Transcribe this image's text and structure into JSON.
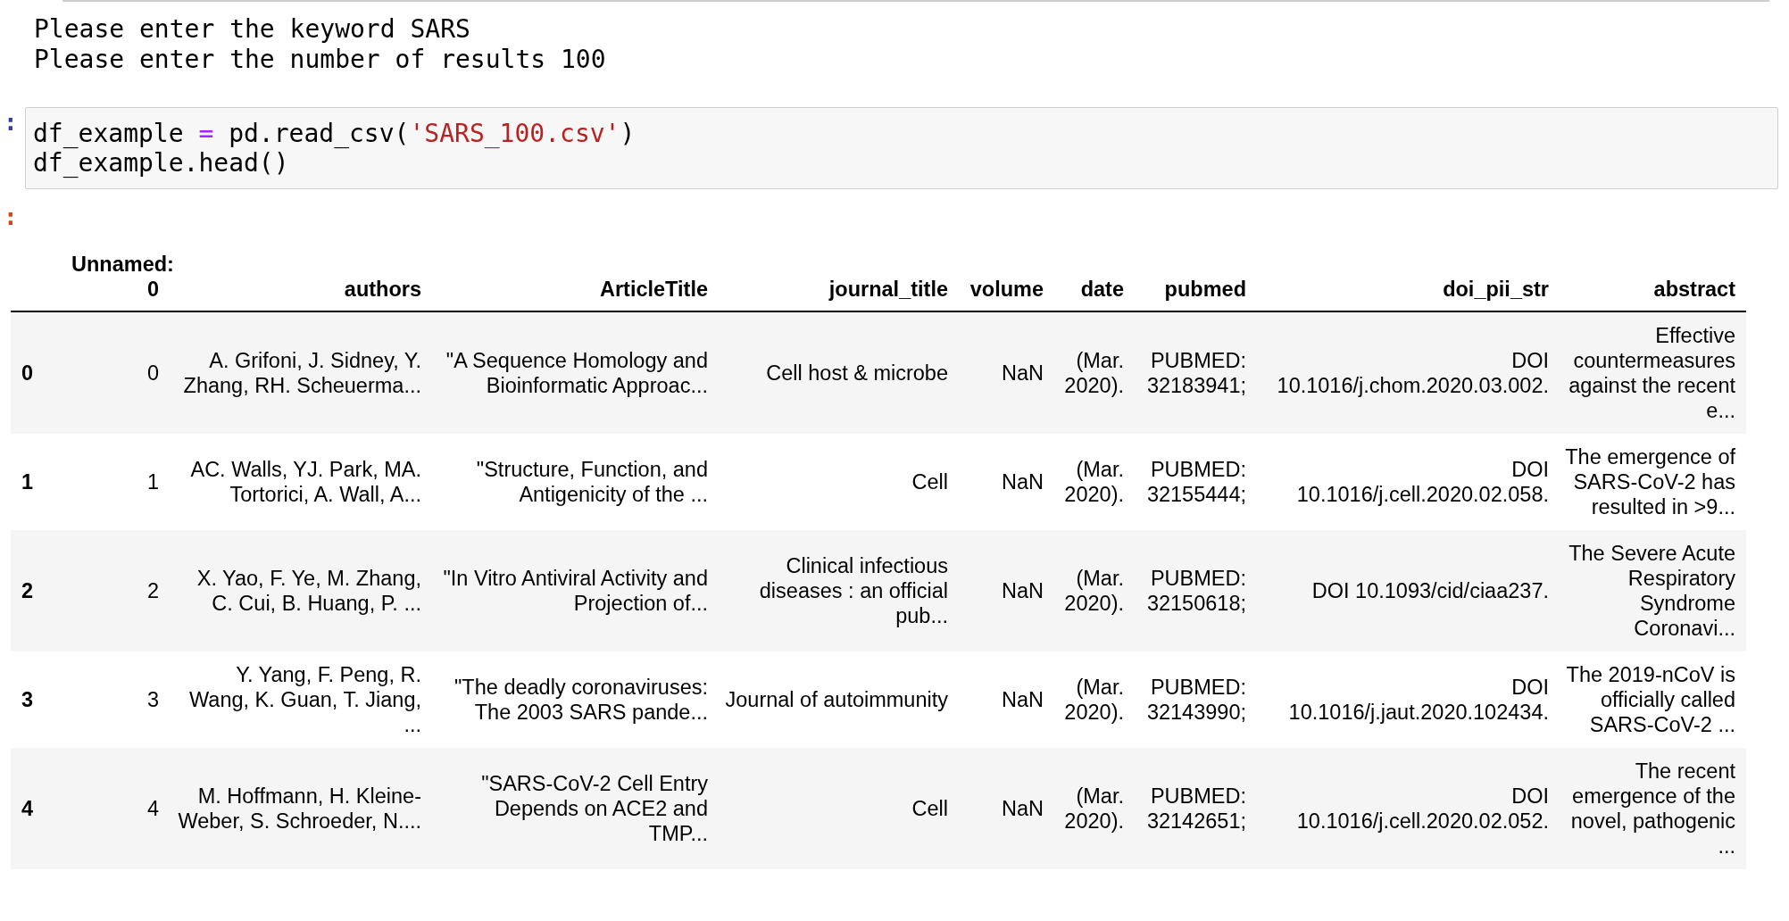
{
  "stdout_lines": [
    "Please enter the keyword SARS",
    "Please enter the number of results 100"
  ],
  "code_cell": {
    "prompt": ":",
    "lines": [
      [
        {
          "text": "df_example ",
          "kind": "plain"
        },
        {
          "text": "=",
          "kind": "operator"
        },
        {
          "text": " pd.read_csv(",
          "kind": "plain"
        },
        {
          "text": "'SARS_100.csv'",
          "kind": "string"
        },
        {
          "text": ")",
          "kind": "plain"
        }
      ],
      [
        {
          "text": "df_example.head()",
          "kind": "plain"
        }
      ]
    ]
  },
  "output_cell": {
    "prompt": ":",
    "table": {
      "columns": [
        "Unnamed: 0",
        "authors",
        "ArticleTitle",
        "journal_title",
        "volume",
        "date",
        "pubmed",
        "doi_pii_str",
        "abstract"
      ],
      "rows": [
        {
          "index": "0",
          "cells": [
            "0",
            "A. Grifoni, J. Sidney, Y. Zhang, RH. Scheuerma...",
            "\"A Sequence Homology and Bioinformatic Approac...",
            "Cell host & microbe",
            "NaN",
            "(Mar. 2020).",
            "PUBMED: 32183941;",
            "DOI 10.1016/j.chom.2020.03.002.",
            "Effective countermeasures against the recent e..."
          ]
        },
        {
          "index": "1",
          "cells": [
            "1",
            "AC. Walls, YJ. Park, MA. Tortorici, A. Wall, A...",
            "\"Structure, Function, and Antigenicity of the ...",
            "Cell",
            "NaN",
            "(Mar. 2020).",
            "PUBMED: 32155444;",
            "DOI 10.1016/j.cell.2020.02.058.",
            "The emergence of SARS-CoV-2 has resulted in >9..."
          ]
        },
        {
          "index": "2",
          "cells": [
            "2",
            "X. Yao, F. Ye, M. Zhang, C. Cui, B. Huang, P. ...",
            "\"In Vitro Antiviral Activity and Projection of...",
            "Clinical infectious diseases : an official pub...",
            "NaN",
            "(Mar. 2020).",
            "PUBMED: 32150618;",
            "DOI 10.1093/cid/ciaa237.",
            "The Severe Acute Respiratory Syndrome Coronavi..."
          ]
        },
        {
          "index": "3",
          "cells": [
            "3",
            "Y. Yang, F. Peng, R. Wang, K. Guan, T. Jiang, ...",
            "\"The deadly coronaviruses: The 2003 SARS pande...",
            "Journal of autoimmunity",
            "NaN",
            "(Mar. 2020).",
            "PUBMED: 32143990;",
            "DOI 10.1016/j.jaut.2020.102434.",
            "The 2019-nCoV is officially called SARS-CoV-2 ..."
          ]
        },
        {
          "index": "4",
          "cells": [
            "4",
            "M. Hoffmann, H. Kleine-Weber, S. Schroeder, N....",
            "\"SARS-CoV-2 Cell Entry Depends on ACE2 and TMP...",
            "Cell",
            "NaN",
            "(Mar. 2020).",
            "PUBMED: 32142651;",
            "DOI 10.1016/j.cell.2020.02.052.",
            "The recent emergence of the novel, pathogenic ..."
          ]
        }
      ]
    }
  }
}
